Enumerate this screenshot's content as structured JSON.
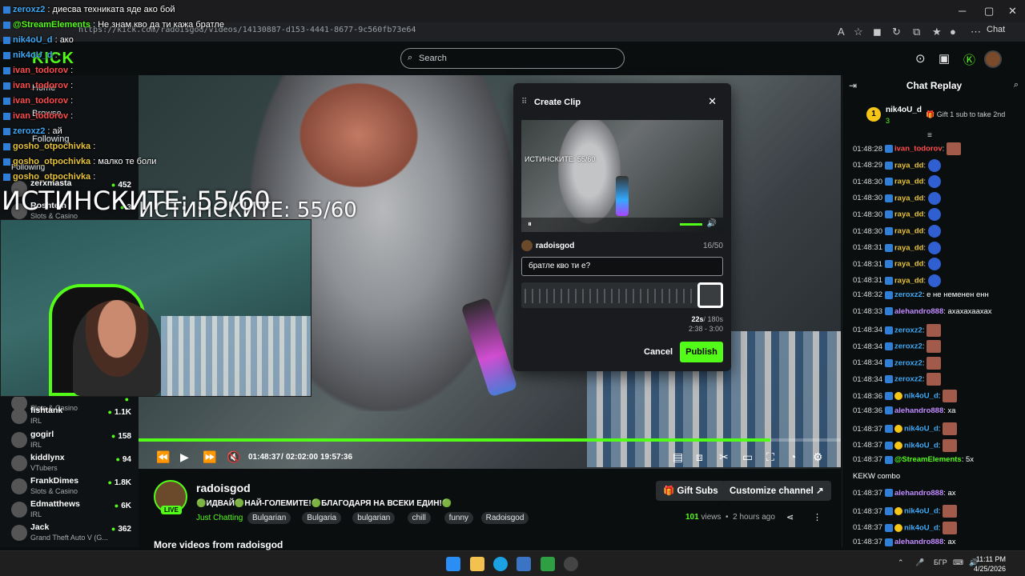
{
  "browser": {
    "url": "https://kick.com/radoisgod/videos/14130887-d153-4441-8677-9c560fb73e64",
    "chat_button": "Chat"
  },
  "header": {
    "logo": "KICK",
    "search_placeholder": "Search"
  },
  "sidebar": {
    "nav": [
      "Home",
      "Browse",
      "Following"
    ],
    "following_label": "Following",
    "channels": [
      {
        "name": "zerxmasta",
        "category": "",
        "viewers": "452"
      },
      {
        "name": "Roshtein",
        "category": "Slots & Casino",
        "viewers": "3"
      },
      {
        "name": "",
        "category": "Slots & Casino",
        "viewers": ""
      },
      {
        "name": "fishtank",
        "category": "IRL",
        "viewers": "1.1K"
      },
      {
        "name": "gogirl",
        "category": "IRL",
        "viewers": "158"
      },
      {
        "name": "kiddlynx",
        "category": "VTubers",
        "viewers": "94"
      },
      {
        "name": "FrankDimes",
        "category": "Slots & Casino",
        "viewers": "1.8K"
      },
      {
        "name": "Edmatthews",
        "category": "IRL",
        "viewers": "6K"
      },
      {
        "name": "Jack",
        "category": "Grand Theft Auto V (G...",
        "viewers": "362"
      }
    ]
  },
  "overlay_chat": [
    {
      "user": "zeroxz2",
      "text": "диесва техниката яде ако бой",
      "color": "#3fa9f5"
    },
    {
      "user": "@StreamElements",
      "text": "Не знам кво да ти кажа братле",
      "color": "#53fc18"
    },
    {
      "user": "nik4oU_d",
      "text": "ако",
      "color": "#3fa9f5"
    },
    {
      "user": "nik4oU_d",
      "text": "",
      "color": "#3fa9f5"
    },
    {
      "user": "ivan_todorov",
      "text": "",
      "color": "#ff4d4d"
    },
    {
      "user": "ivan_todorov",
      "text": "",
      "color": "#ff4d4d"
    },
    {
      "user": "ivan_todorov",
      "text": "",
      "color": "#ff4d4d"
    },
    {
      "user": "ivan_todorov",
      "text": "",
      "color": "#ff4d4d"
    },
    {
      "user": "zeroxz2",
      "text": "ай",
      "color": "#3fa9f5"
    },
    {
      "user": "gosho_otpochivka",
      "text": "",
      "color": "#e6c33a"
    },
    {
      "user": "gosho_otpochivka",
      "text": "малко те боли",
      "color": "#e6c33a"
    },
    {
      "user": "gosho_otpochivka",
      "text": "",
      "color": "#e6c33a"
    }
  ],
  "player": {
    "overlay_text": "ИСТИНСКИТЕ: 55/60",
    "progress": 0.9,
    "current_time": "01:48:37",
    "duration": "02:02:00",
    "clock": "19:57:36"
  },
  "channel": {
    "name": "radoisgod",
    "live": "LIVE",
    "title": "🟢ИДВАЙ🟢НАЙ-ГОЛЕМИТЕ!🟢БЛАГОДАРЯ НА ВСЕКИ ЕДИН!🟢",
    "category": "Just Chatting",
    "tags": [
      "Bulgarian",
      "Bulgaria",
      "bulgarian",
      "chill",
      "funny",
      "Radoisgod"
    ],
    "views_count": "101",
    "views_label": "views",
    "ago": "2 hours ago",
    "gift_subs": "Gift Subs",
    "customize": "Customize channel",
    "more_videos": "More videos from radoisgod"
  },
  "clip_modal": {
    "title": "Create Clip",
    "preview_text": "ИСТИНСКИТЕ: 55/60",
    "user": "radoisgod",
    "char_count": "16/50",
    "input_value": "братле кво ти е?",
    "duration_sel": "22s",
    "duration_max": "/ 180s",
    "range": "2:38 - 3:00",
    "cancel": "Cancel",
    "publish": "Publish"
  },
  "chat": {
    "title": "Chat Replay",
    "pinned_user": "nik4oU_d",
    "pinned_rank": "1",
    "pinned_subs": "3",
    "gift_text": "Gift 1 sub to take 2nd",
    "messages": [
      {
        "ts": "01:48:28",
        "user": "ivan_todorov",
        "text": "",
        "color": "#ff4d4d",
        "emote": "red"
      },
      {
        "ts": "01:48:29",
        "user": "raya_dd",
        "text": "",
        "color": "#e6c33a",
        "emote": "blue"
      },
      {
        "ts": "01:48:30",
        "user": "raya_dd",
        "text": "",
        "color": "#e6c33a",
        "emote": "blue"
      },
      {
        "ts": "01:48:30",
        "user": "raya_dd",
        "text": "",
        "color": "#e6c33a",
        "emote": "blue"
      },
      {
        "ts": "01:48:30",
        "user": "raya_dd",
        "text": "",
        "color": "#e6c33a",
        "emote": "blue"
      },
      {
        "ts": "01:48:30",
        "user": "raya_dd",
        "text": "",
        "color": "#e6c33a",
        "emote": "blue"
      },
      {
        "ts": "01:48:31",
        "user": "raya_dd",
        "text": "",
        "color": "#e6c33a",
        "emote": "blue"
      },
      {
        "ts": "01:48:31",
        "user": "raya_dd",
        "text": "",
        "color": "#e6c33a",
        "emote": "blue"
      },
      {
        "ts": "01:48:31",
        "user": "raya_dd",
        "text": "",
        "color": "#e6c33a",
        "emote": "blue"
      },
      {
        "ts": "01:48:32",
        "user": "zeroxz2",
        "text": "е не неменен енн",
        "color": "#3fa9f5",
        "emote": ""
      },
      {
        "ts": "01:48:33",
        "user": "alehandro888",
        "text": "ахахахаахах",
        "color": "#c08cff",
        "emote": ""
      },
      {
        "ts": "01:48:34",
        "user": "zeroxz2",
        "text": "",
        "color": "#3fa9f5",
        "emote": "red"
      },
      {
        "ts": "01:48:34",
        "user": "zeroxz2",
        "text": "",
        "color": "#3fa9f5",
        "emote": "red"
      },
      {
        "ts": "01:48:34",
        "user": "zeroxz2",
        "text": "",
        "color": "#3fa9f5",
        "emote": "red"
      },
      {
        "ts": "01:48:34",
        "user": "zeroxz2",
        "text": "",
        "color": "#3fa9f5",
        "emote": "red"
      },
      {
        "ts": "01:48:36",
        "user": "nik4oU_d",
        "text": "",
        "color": "#3fa9f5",
        "emote": "red"
      },
      {
        "ts": "01:48:36",
        "user": "alehandro888",
        "text": "ха",
        "color": "#c08cff",
        "emote": ""
      },
      {
        "ts": "01:48:37",
        "user": "nik4oU_d",
        "text": "",
        "color": "#3fa9f5",
        "emote": "red"
      },
      {
        "ts": "01:48:37",
        "user": "nik4oU_d",
        "text": "",
        "color": "#3fa9f5",
        "emote": "red"
      },
      {
        "ts": "01:48:37",
        "user": "@StreamElements",
        "text": "5x",
        "color": "#53fc18",
        "emote": ""
      },
      {
        "ts": "",
        "user": "",
        "text": "KEKW combo",
        "color": "#fff",
        "emote": ""
      },
      {
        "ts": "01:48:37",
        "user": "alehandro888",
        "text": "ах",
        "color": "#c08cff",
        "emote": ""
      },
      {
        "ts": "01:48:37",
        "user": "nik4oU_d",
        "text": "",
        "color": "#3fa9f5",
        "emote": "red"
      },
      {
        "ts": "01:48:37",
        "user": "nik4oU_d",
        "text": "",
        "color": "#3fa9f5",
        "emote": "red"
      },
      {
        "ts": "01:48:37",
        "user": "alehandro888",
        "text": "ах",
        "color": "#c08cff",
        "emote": ""
      }
    ]
  },
  "taskbar": {
    "lang": "БГР",
    "time": "11:11 PM",
    "date": "4/25/2026"
  },
  "colors": {
    "accent": "#53fc18",
    "bg": "#0b0e0f"
  }
}
